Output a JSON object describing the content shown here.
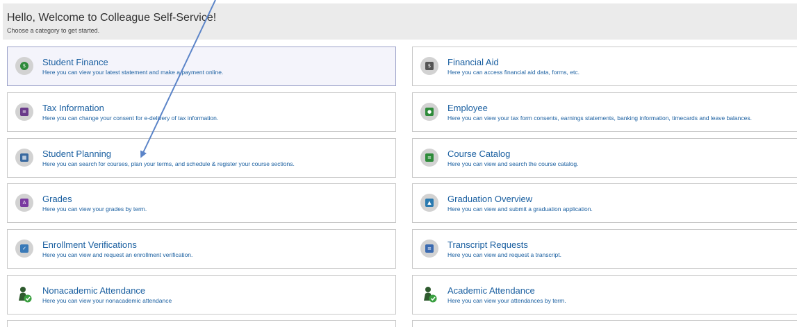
{
  "header": {
    "title": "Hello, Welcome to Colleague Self-Service!",
    "subtitle": "Choose a category to get started."
  },
  "categories": [
    {
      "label": "Student Finance",
      "desc": "Here you can view your latest statement and make a payment online.",
      "icon": "money-icon",
      "icon_color": "#2e8b3a"
    },
    {
      "label": "Financial Aid",
      "desc": "Here you can access financial aid data, forms, etc.",
      "icon": "dollar-bill-icon",
      "icon_color": "#555555"
    },
    {
      "label": "Tax Information",
      "desc": "Here you can change your consent for e-delivery of tax information.",
      "icon": "tax-form-icon",
      "icon_color": "#6a3a8a"
    },
    {
      "label": "Employee",
      "desc": "Here you can view your tax form consents, earnings statements, banking information, timecards and leave balances.",
      "icon": "employee-badge-icon",
      "icon_color": "#2e8b3a"
    },
    {
      "label": "Student Planning",
      "desc": "Here you can search for courses, plan your terms, and schedule & register your course sections.",
      "icon": "calendar-plan-icon",
      "icon_color": "#3a6aa0"
    },
    {
      "label": "Course Catalog",
      "desc": "Here you can view and search the course catalog.",
      "icon": "catalog-book-icon",
      "icon_color": "#2e8b3a"
    },
    {
      "label": "Grades",
      "desc": "Here you can view your grades by term.",
      "icon": "grades-icon",
      "icon_color": "#7a3aa0"
    },
    {
      "label": "Graduation Overview",
      "desc": "Here you can view and submit a graduation application.",
      "icon": "graduation-cap-icon",
      "icon_color": "#2a7ab0"
    },
    {
      "label": "Enrollment Verifications",
      "desc": "Here you can view and request an enrollment verification.",
      "icon": "verification-icon",
      "icon_color": "#3a7ab8"
    },
    {
      "label": "Transcript Requests",
      "desc": "Here you can view and request a transcript.",
      "icon": "transcript-icon",
      "icon_color": "#3a6ab0"
    },
    {
      "label": "Nonacademic Attendance",
      "desc": "Here you can view your nonacademic attendance",
      "icon": "attendance-person-icon",
      "icon_color": "#2e7a3a"
    },
    {
      "label": "Academic Attendance",
      "desc": "Here you can view your attendances by term.",
      "icon": "attendance-person-icon",
      "icon_color": "#2e7a3a"
    }
  ],
  "colors": {
    "link": "#1a5fa0",
    "header_bg": "#ebebeb",
    "arrow": "#5b84c8"
  }
}
